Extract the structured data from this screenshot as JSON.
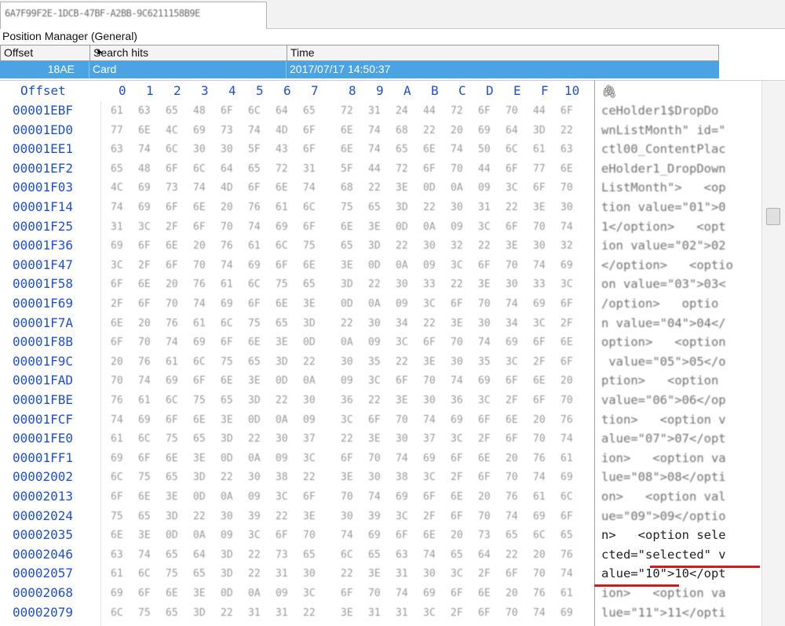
{
  "tab": {
    "title": "6A7F99F2E-1DCB-47BF-A2BB-9C6211158B9E",
    "prefix": "6"
  },
  "position_manager": {
    "title": "Position Manager (General)",
    "columns": [
      "Offset",
      "Search hits",
      "Time"
    ],
    "rows": [
      {
        "offset": "18AE",
        "search_hit": "Card",
        "time": "2017/07/17  14:50:37"
      }
    ]
  },
  "hex_view": {
    "offset_header": "Offset",
    "column_headers": [
      "0",
      "1",
      "2",
      "3",
      "4",
      "5",
      "6",
      "7",
      "8",
      "9",
      "A",
      "B",
      "C",
      "D",
      "E",
      "F",
      "10"
    ],
    "rows": [
      {
        "offset": "00001EBF",
        "bytes": [
          "61",
          "63",
          "65",
          "48",
          "6F",
          "6C",
          "64",
          "65",
          "72",
          "31",
          "24",
          "44",
          "72",
          "6F",
          "70",
          "44",
          "6F"
        ],
        "text": "ceHolder1$DropDo"
      },
      {
        "offset": "00001ED0",
        "bytes": [
          "77",
          "6E",
          "4C",
          "69",
          "73",
          "74",
          "4D",
          "6F",
          "6E",
          "74",
          "68",
          "22",
          "20",
          "69",
          "64",
          "3D",
          "22"
        ],
        "text": "wnListMonth\" id=\""
      },
      {
        "offset": "00001EE1",
        "bytes": [
          "63",
          "74",
          "6C",
          "30",
          "30",
          "5F",
          "43",
          "6F",
          "6E",
          "74",
          "65",
          "6E",
          "74",
          "50",
          "6C",
          "61",
          "63"
        ],
        "text": "ctl00_ContentPlac"
      },
      {
        "offset": "00001EF2",
        "bytes": [
          "65",
          "48",
          "6F",
          "6C",
          "64",
          "65",
          "72",
          "31",
          "5F",
          "44",
          "72",
          "6F",
          "70",
          "44",
          "6F",
          "77",
          "6E"
        ],
        "text": "eHolder1_DropDown"
      },
      {
        "offset": "00001F03",
        "bytes": [
          "4C",
          "69",
          "73",
          "74",
          "4D",
          "6F",
          "6E",
          "74",
          "68",
          "22",
          "3E",
          "0D",
          "0A",
          "09",
          "3C",
          "6F",
          "70"
        ],
        "text": "ListMonth\">   <op"
      },
      {
        "offset": "00001F14",
        "bytes": [
          "74",
          "69",
          "6F",
          "6E",
          "20",
          "76",
          "61",
          "6C",
          "75",
          "65",
          "3D",
          "22",
          "30",
          "31",
          "22",
          "3E",
          "30"
        ],
        "text": "tion value=\"01\">0"
      },
      {
        "offset": "00001F25",
        "bytes": [
          "31",
          "3C",
          "2F",
          "6F",
          "70",
          "74",
          "69",
          "6F",
          "6E",
          "3E",
          "0D",
          "0A",
          "09",
          "3C",
          "6F",
          "70",
          "74"
        ],
        "text": "1</option>   <opt"
      },
      {
        "offset": "00001F36",
        "bytes": [
          "69",
          "6F",
          "6E",
          "20",
          "76",
          "61",
          "6C",
          "75",
          "65",
          "3D",
          "22",
          "30",
          "32",
          "22",
          "3E",
          "30",
          "32"
        ],
        "text": "ion value=\"02\">02"
      },
      {
        "offset": "00001F47",
        "bytes": [
          "3C",
          "2F",
          "6F",
          "70",
          "74",
          "69",
          "6F",
          "6E",
          "3E",
          "0D",
          "0A",
          "09",
          "3C",
          "6F",
          "70",
          "74",
          "69"
        ],
        "text": "</option>   <optio"
      },
      {
        "offset": "00001F58",
        "bytes": [
          "6F",
          "6E",
          "20",
          "76",
          "61",
          "6C",
          "75",
          "65",
          "3D",
          "22",
          "30",
          "33",
          "22",
          "3E",
          "30",
          "33",
          "3C"
        ],
        "text": "on value=\"03\">03<"
      },
      {
        "offset": "00001F69",
        "bytes": [
          "2F",
          "6F",
          "70",
          "74",
          "69",
          "6F",
          "6E",
          "3E",
          "0D",
          "0A",
          "09",
          "3C",
          "6F",
          "70",
          "74",
          "69",
          "6F"
        ],
        "text": "/option>   optio"
      },
      {
        "offset": "00001F7A",
        "bytes": [
          "6E",
          "20",
          "76",
          "61",
          "6C",
          "75",
          "65",
          "3D",
          "22",
          "30",
          "34",
          "22",
          "3E",
          "30",
          "34",
          "3C",
          "2F"
        ],
        "text": "n value=\"04\">04</"
      },
      {
        "offset": "00001F8B",
        "bytes": [
          "6F",
          "70",
          "74",
          "69",
          "6F",
          "6E",
          "3E",
          "0D",
          "0A",
          "09",
          "3C",
          "6F",
          "70",
          "74",
          "69",
          "6F",
          "6E"
        ],
        "text": "option>   <option"
      },
      {
        "offset": "00001F9C",
        "bytes": [
          "20",
          "76",
          "61",
          "6C",
          "75",
          "65",
          "3D",
          "22",
          "30",
          "35",
          "22",
          "3E",
          "30",
          "35",
          "3C",
          "2F",
          "6F"
        ],
        "text": " value=\"05\">05</o"
      },
      {
        "offset": "00001FAD",
        "bytes": [
          "70",
          "74",
          "69",
          "6F",
          "6E",
          "3E",
          "0D",
          "0A",
          "09",
          "3C",
          "6F",
          "70",
          "74",
          "69",
          "6F",
          "6E",
          "20"
        ],
        "text": "ption>   <option "
      },
      {
        "offset": "00001FBE",
        "bytes": [
          "76",
          "61",
          "6C",
          "75",
          "65",
          "3D",
          "22",
          "30",
          "36",
          "22",
          "3E",
          "30",
          "36",
          "3C",
          "2F",
          "6F",
          "70"
        ],
        "text": "value=\"06\">06</op"
      },
      {
        "offset": "00001FCF",
        "bytes": [
          "74",
          "69",
          "6F",
          "6E",
          "3E",
          "0D",
          "0A",
          "09",
          "3C",
          "6F",
          "70",
          "74",
          "69",
          "6F",
          "6E",
          "20",
          "76"
        ],
        "text": "tion>   <option v"
      },
      {
        "offset": "00001FE0",
        "bytes": [
          "61",
          "6C",
          "75",
          "65",
          "3D",
          "22",
          "30",
          "37",
          "22",
          "3E",
          "30",
          "37",
          "3C",
          "2F",
          "6F",
          "70",
          "74"
        ],
        "text": "alue=\"07\">07</opt"
      },
      {
        "offset": "00001FF1",
        "bytes": [
          "69",
          "6F",
          "6E",
          "3E",
          "0D",
          "0A",
          "09",
          "3C",
          "6F",
          "70",
          "74",
          "69",
          "6F",
          "6E",
          "20",
          "76",
          "61"
        ],
        "text": "ion>   <option va"
      },
      {
        "offset": "00002002",
        "bytes": [
          "6C",
          "75",
          "65",
          "3D",
          "22",
          "30",
          "38",
          "22",
          "3E",
          "30",
          "38",
          "3C",
          "2F",
          "6F",
          "70",
          "74",
          "69"
        ],
        "text": "lue=\"08\">08</opti"
      },
      {
        "offset": "00002013",
        "bytes": [
          "6F",
          "6E",
          "3E",
          "0D",
          "0A",
          "09",
          "3C",
          "6F",
          "70",
          "74",
          "69",
          "6F",
          "6E",
          "20",
          "76",
          "61",
          "6C"
        ],
        "text": "on>   <option val"
      },
      {
        "offset": "00002024",
        "bytes": [
          "75",
          "65",
          "3D",
          "22",
          "30",
          "39",
          "22",
          "3E",
          "30",
          "39",
          "3C",
          "2F",
          "6F",
          "70",
          "74",
          "69",
          "6F"
        ],
        "text": "ue=\"09\">09</optio"
      },
      {
        "offset": "00002035",
        "bytes": [
          "6E",
          "3E",
          "0D",
          "0A",
          "09",
          "3C",
          "6F",
          "70",
          "74",
          "69",
          "6F",
          "6E",
          "20",
          "73",
          "65",
          "6C",
          "65"
        ],
        "text": "n>   <option sele"
      },
      {
        "offset": "00002046",
        "bytes": [
          "63",
          "74",
          "65",
          "64",
          "3D",
          "22",
          "73",
          "65",
          "6C",
          "65",
          "63",
          "74",
          "65",
          "64",
          "22",
          "20",
          "76"
        ],
        "text": "cted=\"selected\" v"
      },
      {
        "offset": "00002057",
        "bytes": [
          "61",
          "6C",
          "75",
          "65",
          "3D",
          "22",
          "31",
          "30",
          "22",
          "3E",
          "31",
          "30",
          "3C",
          "2F",
          "6F",
          "70",
          "74"
        ],
        "text": "alue=\"10\">10</opt"
      },
      {
        "offset": "00002068",
        "bytes": [
          "69",
          "6F",
          "6E",
          "3E",
          "0D",
          "0A",
          "09",
          "3C",
          "6F",
          "70",
          "74",
          "69",
          "6F",
          "6E",
          "20",
          "76",
          "61"
        ],
        "text": "ion>   <option va"
      },
      {
        "offset": "00002079",
        "bytes": [
          "6C",
          "75",
          "65",
          "3D",
          "22",
          "31",
          "31",
          "22",
          "3E",
          "31",
          "31",
          "3C",
          "2F",
          "6F",
          "70",
          "74",
          "69"
        ],
        "text": "lue=\"11\">11</opti"
      }
    ],
    "highlighted_text_rows": [
      22,
      23,
      24
    ],
    "clip_icon": "paperclip-icon"
  },
  "colors": {
    "selection": "#4ba3e3",
    "offset_blue": "#1d4fd8",
    "highlight_red": "#d7191c"
  }
}
